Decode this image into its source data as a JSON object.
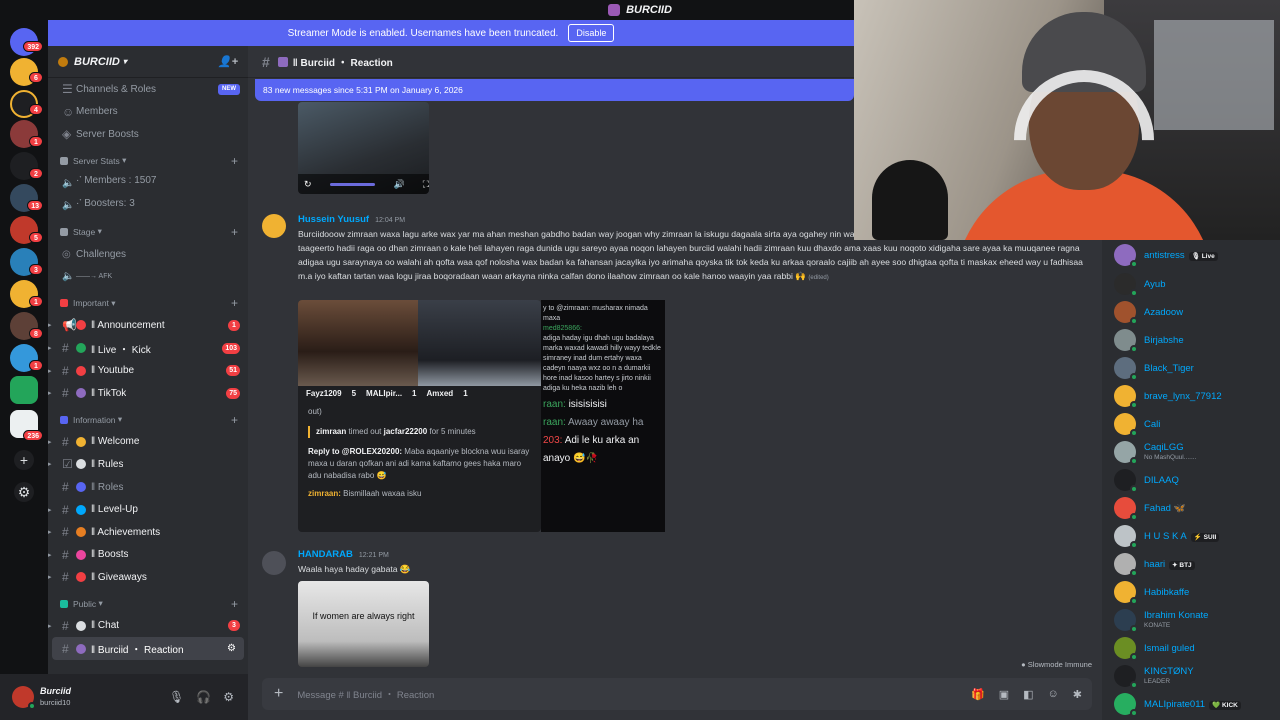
{
  "titlebar": {
    "title": "BURCIID"
  },
  "banner": {
    "text": "Streamer Mode is enabled. Usernames have been truncated.",
    "disable_label": "Disable"
  },
  "rail": {
    "badges": [
      "392",
      "6",
      "4",
      "1",
      "2",
      "13",
      "5",
      "3",
      "1",
      "8",
      "1",
      "236"
    ],
    "add_icon": "+",
    "discover_icon": "⚙"
  },
  "server": {
    "name": "BURCIID",
    "channels_roles": "Channels & Roles",
    "new_badge": "NEW",
    "members": "Members",
    "boosts": "Server Boosts",
    "categories": {
      "stats": "Server Stats",
      "stage": "Stage",
      "important": "Important",
      "information": "Information",
      "public": "Public"
    },
    "stats": {
      "members": "·་ Members : 1507",
      "boosters": "·་ Boosters: 3"
    },
    "stage": {
      "challenges": "Challenges",
      "afk": "——→ AFK"
    },
    "important": [
      {
        "name": "‖ Announcement",
        "count": "1",
        "color": "#f23f43"
      },
      {
        "name": "‖ Live ・ Kick",
        "count": "103",
        "color": "#23a55a"
      },
      {
        "name": "‖ Youtube",
        "count": "51",
        "color": "#f23f43"
      },
      {
        "name": "‖ TikTok",
        "count": "75",
        "color": "#8e6bbf"
      }
    ],
    "information": [
      {
        "name": "‖ Welcome",
        "color": "#f0b232"
      },
      {
        "name": "‖ Rules",
        "color": "#dbdee1"
      },
      {
        "name": "‖ Roles",
        "color": "#5865f2"
      },
      {
        "name": "‖ Level-Up",
        "color": "#00a8fc"
      },
      {
        "name": "‖ Achievements",
        "color": "#e67e22"
      },
      {
        "name": "‖ Boosts",
        "color": "#eb459e"
      },
      {
        "name": "‖ Giveaways",
        "color": "#f23f43"
      }
    ],
    "public": [
      {
        "name": "‖ Chat",
        "count": "3",
        "color": "#dbdee1"
      },
      {
        "name": "‖ Burciid ・ Reaction",
        "color": "#8e6bbf"
      }
    ]
  },
  "user": {
    "display": "Burciid",
    "username": "burciid10"
  },
  "channel": {
    "title": "‖ Burciid ・ Reaction",
    "new_messages": "83 new messages since 5:31 PM on January 6, 2026"
  },
  "messages": [
    {
      "author": "Hussein Yuusuf",
      "time": "12:04 PM",
      "text": "Burciidooow zimraan waxa lagu arke wax yar ma ahan meshan gabdho badan way joogan why zimraan la iskugu dagaala sirta aya ogahey nin walbo wuxuu rabaa gabar zimraan o kale oo nolosha ku taageerto hadii raga oo dhan zimraan o kale heli lahayen raga dunida ugu sareyo ayaa noqon lahayen burciid walahi hadii zimraan kuu dhaxdo ama xaas kuu noqoto xidigaha sare ayaa ka muuqanee ragna adigaa ugu saraynaya oo walahi ah  qofta waa qof nolosha wax badan ka fahansan jacaylka iyo  arimaha qoyska tik tok keda ku arkaa qoraalo cajiib ah ayee soo dhigtaa qofta ti maskax eheed way u fadhisaa m.a iyo kaftan  tartan waa logu jiraa boqoradaan waan arkayna ninka calfan dono ilaahow zimraan oo  kale hanoo waayin yaa rabbi 🙌",
      "edited": "(edited)"
    },
    {
      "author": "HANDARAB",
      "time": "12:21 PM",
      "text": "Waala haya haday gabata 😂"
    }
  ],
  "embed_left": {
    "names": [
      "Fayz1209",
      "5",
      "MALIpir...",
      "1",
      "Amxed",
      "1"
    ],
    "out": "out)",
    "timeout_user": "zimraan",
    "timeout_text": "timed out",
    "timeout_target": "jacfar22200",
    "timeout_dur": "for 5 minutes",
    "reply": "Reply to @ROLEX20200:",
    "reply_text": "Maba aqaaniye blockna wuu isaray maxa u daran qofkan ani adi kama kaftamo gees haka maro adu nabadisa rabo 😅",
    "last_user": "zimraan:",
    "last_text": "Bismillaah waxaa isku"
  },
  "embed_right": {
    "l1": "y to @zimraan: musharax nimada maxa",
    "l2": "med825866:",
    "l3": "adiga haday igu dhah ugu badalaya marka waxad kawadi hilly wayy tedkle simraney inad dum ertahy waxa cadeyn naaya wxz oo n a dumarkii hore inad kasoo hartey s jirto ninkii adiga ku heka nazib leh o",
    "b1a": "raan:",
    "b1b": "isisisisisi",
    "b2a": "raan:",
    "b2b": "Awaay awaay ha",
    "b3a": "203:",
    "b3b": "Adi le ku arka an",
    "b4": "anayo 😅🥀"
  },
  "meme_text": "If women are always right",
  "slowmode": "Slowmode Immune",
  "composer": {
    "placeholder": "Message # ‖ Burciid ・ Reaction"
  },
  "members": [
    {
      "name": "antistress",
      "tag": "🎙 Live",
      "color": "#8e6bbf"
    },
    {
      "name": "Ayub",
      "color": "#2b2b2b"
    },
    {
      "name": "Azadoow",
      "color": "#a0522d"
    },
    {
      "name": "Birjabshe",
      "color": "#7f8c8d"
    },
    {
      "name": "Black_Tiger",
      "color": "#5d6d7e"
    },
    {
      "name": "brave_lynx_77912",
      "color": "#f0b232"
    },
    {
      "name": "Cali",
      "color": "#f0b232"
    },
    {
      "name": "CaqiLGG",
      "sub": "No MashQuul.......",
      "color": "#95a5a6"
    },
    {
      "name": "DILAAQ",
      "color": "#1e1f22"
    },
    {
      "name": "Fahad 🦋",
      "color": "#e74c3c"
    },
    {
      "name": "H U S K A",
      "tag": "⚡ SUII",
      "color": "#bdc3c7"
    },
    {
      "name": "haari",
      "tag": "✦ BTJ",
      "color": "#b0b0b0"
    },
    {
      "name": "Habibkaffe",
      "color": "#f0b232"
    },
    {
      "name": "Ibrahim Konate",
      "sub": "KONATE",
      "color": "#2c3e50"
    },
    {
      "name": "Ismail guled",
      "color": "#6b8e23"
    },
    {
      "name": "KINGTØNY",
      "sub": "LEADER",
      "color": "#1e1f22"
    },
    {
      "name": "MALIpirate011",
      "tag": "💚 KICK",
      "color": "#27ae60"
    }
  ]
}
